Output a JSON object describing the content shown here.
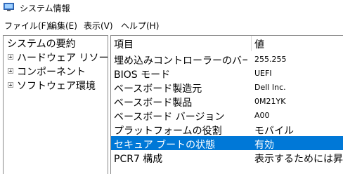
{
  "window": {
    "title": "システム情報"
  },
  "menu": [
    {
      "label": "ファイル(F)"
    },
    {
      "label": "編集(E)"
    },
    {
      "label": "表示(V)"
    },
    {
      "label": "ヘルプ(H)"
    }
  ],
  "tree": {
    "root": "システムの要約",
    "children": [
      {
        "label": "ハードウェア リソース"
      },
      {
        "label": "コンポーネント"
      },
      {
        "label": "ソフトウェア環境"
      }
    ]
  },
  "table": {
    "headers": {
      "item": "項目",
      "value": "値"
    },
    "rows": [
      {
        "item": "埋め込みコントローラーのバー...",
        "value": "255.255"
      },
      {
        "item": "BIOS モード",
        "value": "UEFI"
      },
      {
        "item": "ベースボード製造元",
        "value": "Dell Inc."
      },
      {
        "item": "ベースボード製品",
        "value": "0M21YK"
      },
      {
        "item": "ベースボード バージョン",
        "value": "A00"
      },
      {
        "item": "プラットフォームの役割",
        "value": "モバイル"
      },
      {
        "item": "セキュア ブートの状態",
        "value": "有効",
        "selected": true
      },
      {
        "item": "PCR7 構成",
        "value": "表示するためには昇"
      }
    ]
  },
  "colors": {
    "selection": "#0078d7"
  },
  "icons": {
    "app": "system-info-icon",
    "expander": "plus-expander-icon"
  }
}
